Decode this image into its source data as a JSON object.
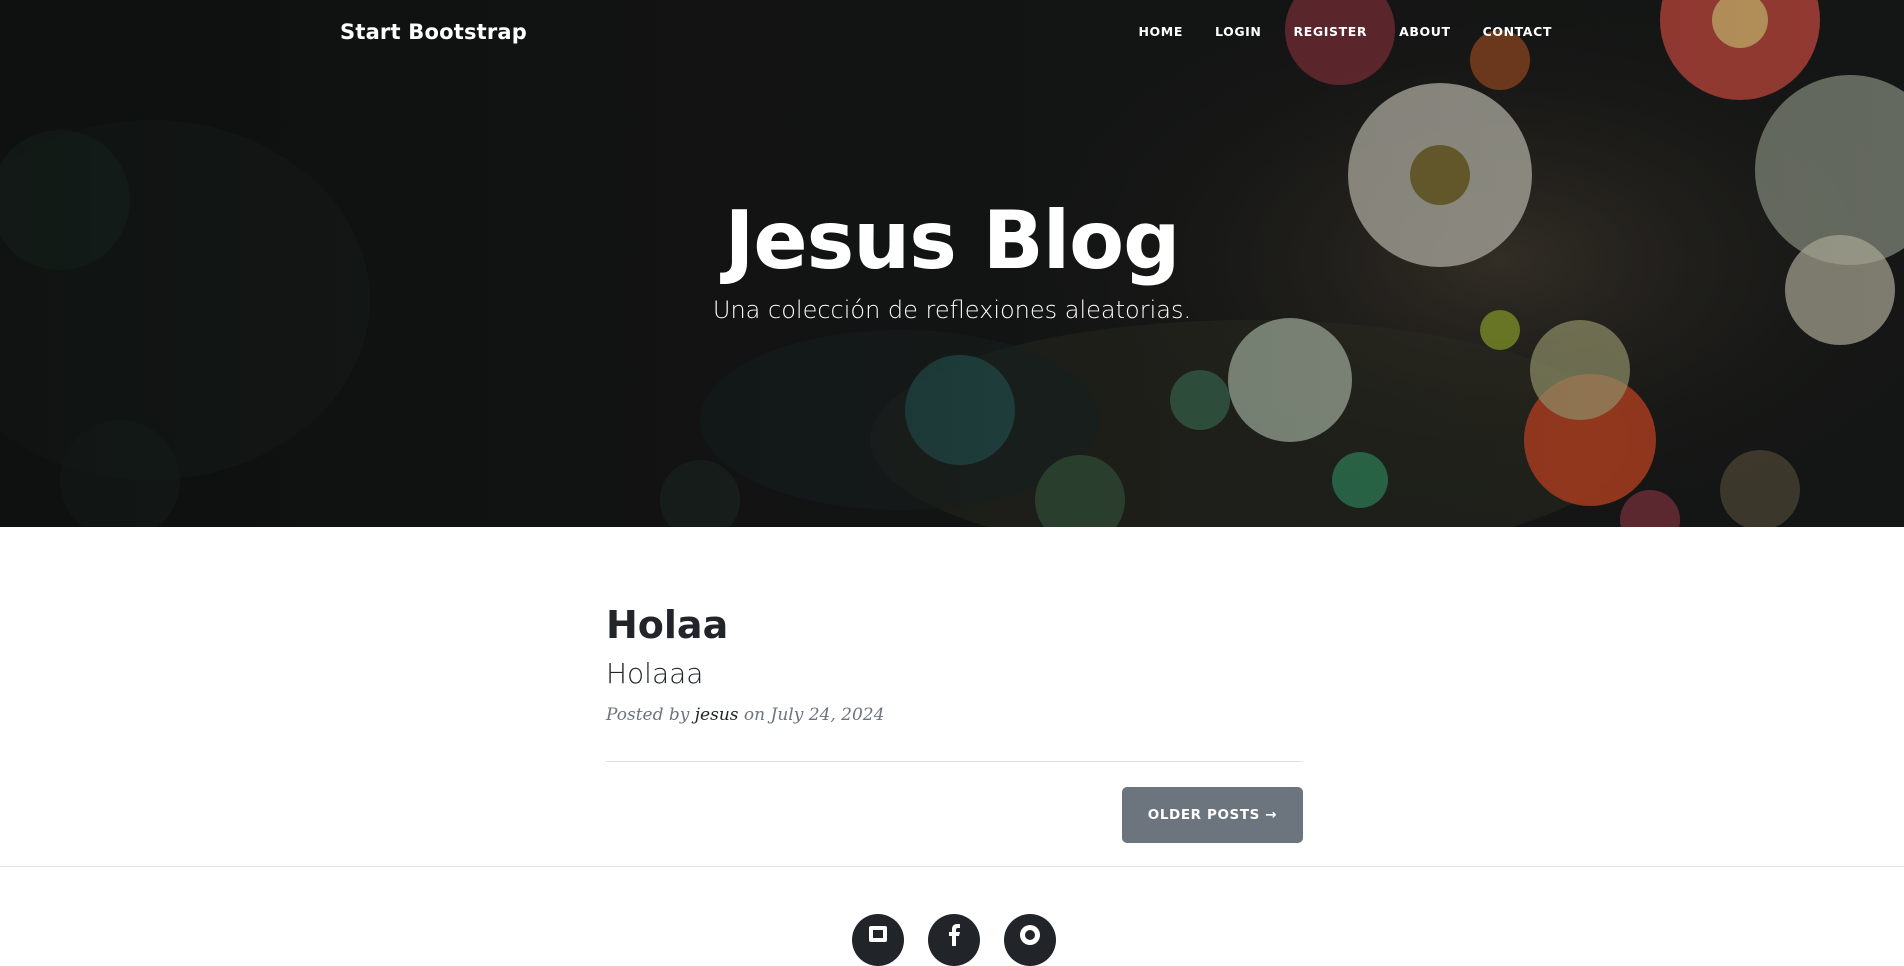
{
  "navbar": {
    "brand": "Start Bootstrap",
    "links": [
      "HOME",
      "LOGIN",
      "REGISTER",
      "ABOUT",
      "CONTACT"
    ]
  },
  "hero": {
    "title": "Jesus Blog",
    "subtitle": "Una colección de reflexiones aleatorias."
  },
  "posts": [
    {
      "title": "Holaa",
      "subtitle": "Holaaa",
      "meta_prefix": "Posted by",
      "author": "jesus",
      "meta_date": "on July 24, 2024"
    }
  ],
  "pager": {
    "older_label": "OLDER POSTS →"
  },
  "footer": {
    "social_icons": [
      "twitter-icon",
      "facebook-icon",
      "github-icon"
    ]
  },
  "colors": {
    "button_bg": "#6c757d",
    "text_dark": "#212529",
    "meta_gray": "#6c757d"
  }
}
